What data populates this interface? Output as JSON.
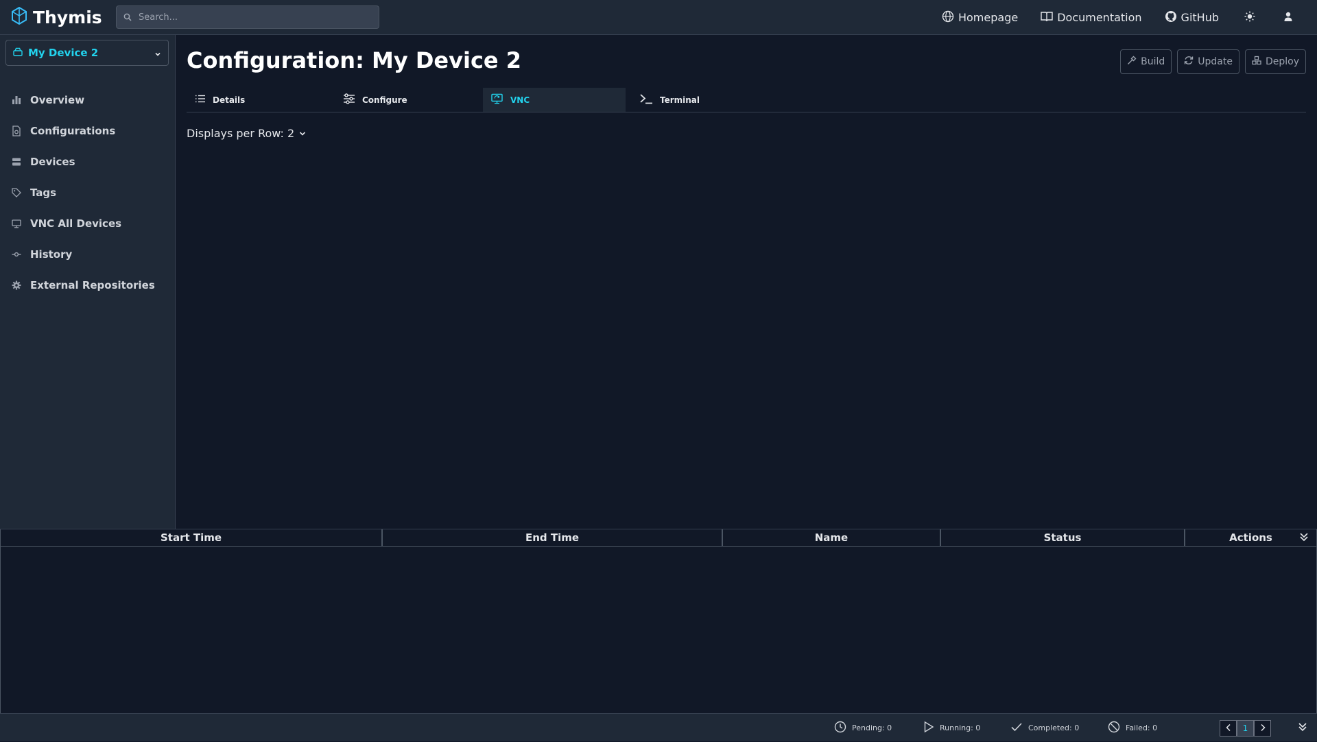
{
  "app": {
    "name": "Thymis",
    "search_placeholder": "Search..."
  },
  "topnav": {
    "homepage": "Homepage",
    "documentation": "Documentation",
    "github": "GitHub"
  },
  "sidebar": {
    "device_selector": "My Device 2",
    "items": [
      {
        "label": "Overview",
        "icon": "bar-chart-icon"
      },
      {
        "label": "Configurations",
        "icon": "file-config-icon"
      },
      {
        "label": "Devices",
        "icon": "server-icon"
      },
      {
        "label": "Tags",
        "icon": "tag-icon"
      },
      {
        "label": "VNC All Devices",
        "icon": "monitor-icon"
      },
      {
        "label": "History",
        "icon": "commit-icon"
      },
      {
        "label": "External Repositories",
        "icon": "gear-icon"
      }
    ]
  },
  "page": {
    "title": "Configuration: My Device 2",
    "buttons": {
      "build": "Build",
      "update": "Update",
      "deploy": "Deploy"
    },
    "tabs": [
      "Details",
      "Configure",
      "VNC",
      "Terminal"
    ],
    "active_tab": "VNC",
    "displays_per_row": "Displays per Row: 2"
  },
  "tasks_table": {
    "headers": [
      "Start Time",
      "End Time",
      "Name",
      "Status",
      "Actions"
    ],
    "rows": []
  },
  "status_bar": {
    "pending": "Pending: 0",
    "running": "Running: 0",
    "completed": "Completed: 0",
    "failed": "Failed: 0",
    "current_page": "1"
  },
  "colors": {
    "accent": "#22d3ee",
    "background": "#111827",
    "panel": "#1f2937"
  }
}
